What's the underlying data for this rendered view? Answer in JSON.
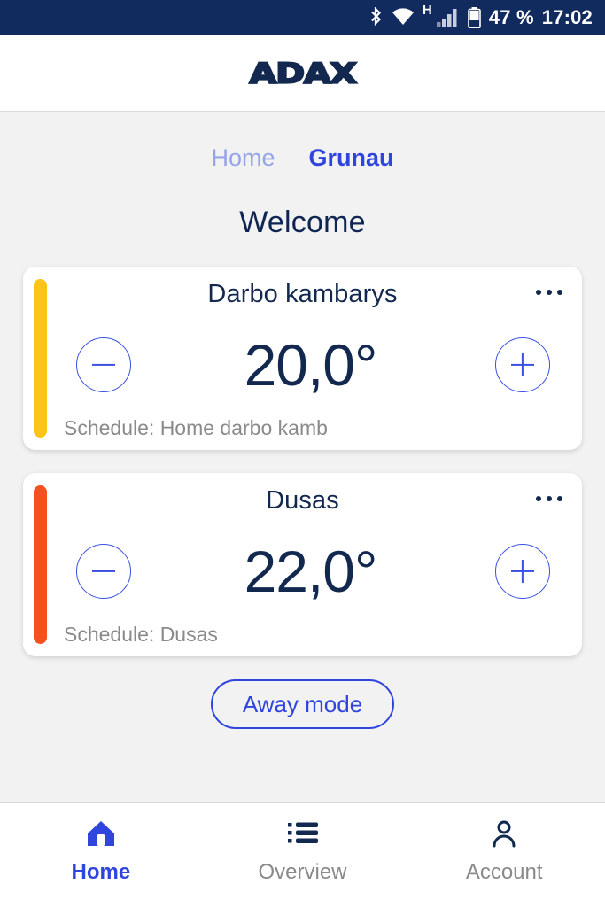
{
  "status_bar": {
    "network_type": "H",
    "battery_percent": "47 %",
    "time": "17:02",
    "icons": [
      "bluetooth-icon",
      "wifi-icon",
      "cellular-signal-icon",
      "battery-icon"
    ],
    "background_color": "#122b5e"
  },
  "header": {
    "logo_text": "ADAX",
    "logo_color": "#13284f"
  },
  "location_tabs": [
    {
      "label": "Home",
      "active": false
    },
    {
      "label": "Grunau",
      "active": true
    }
  ],
  "main": {
    "welcome_title": "Welcome",
    "away_button_label": "Away mode",
    "rooms": [
      {
        "name": "Darbo kambarys",
        "temperature": "20,0°",
        "schedule": "Schedule: Home darbo kamb",
        "accent_color": "#fcc419",
        "decrease_label": "−",
        "increase_label": "+",
        "menu_label": "..."
      },
      {
        "name": "Dusas",
        "temperature": "22,0°",
        "schedule": "Schedule: Dusas",
        "accent_color": "#f4511e",
        "decrease_label": "−",
        "increase_label": "+",
        "menu_label": "..."
      }
    ]
  },
  "bottom_nav": [
    {
      "label": "Home",
      "icon": "home-icon",
      "active": true
    },
    {
      "label": "Overview",
      "icon": "list-icon",
      "active": false
    },
    {
      "label": "Account",
      "icon": "person-icon",
      "active": false
    }
  ],
  "colors": {
    "accent_blue": "#2f45dd",
    "navy": "#13284f",
    "muted_gray": "#8a8a8a",
    "page_bg": "#f2f2f2"
  }
}
